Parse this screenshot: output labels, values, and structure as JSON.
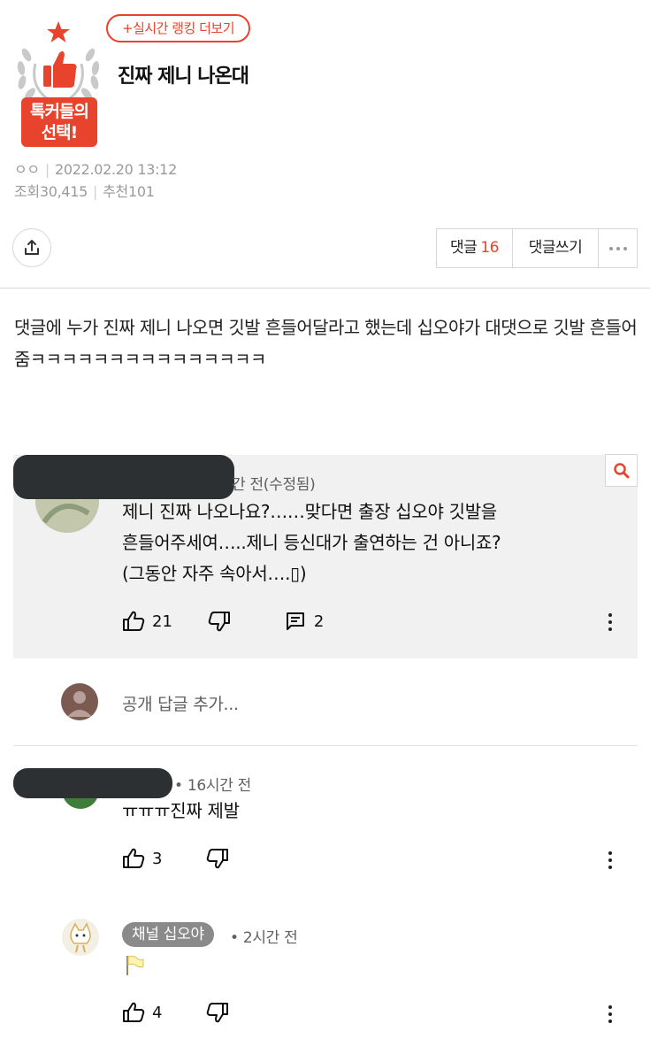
{
  "header": {
    "badge_text_1": "톡커들의",
    "badge_text_2": "선택!",
    "ranking_button": "+실시간 랭킹 더보기",
    "title": "진짜 제니 나온대"
  },
  "meta": {
    "author": "ㅇㅇ",
    "datetime": "2022.02.20 13:12",
    "views_label": "조회",
    "views": "30,415",
    "likes_label": "추천",
    "likes": "101"
  },
  "actions": {
    "comments_label": "댓글",
    "comments_count": "16",
    "write_label": "댓글쓰기"
  },
  "post": {
    "body": "댓글에 누가 진짜 제니 나오면 깃발 흔들어달라고 했는데 십오야가 대댓으로 깃발 흔들어줌ㅋㅋㅋㅋㅋㅋㅋㅋㅋㅋㅋㅋㅋㅋㅋ"
  },
  "screenshot": {
    "comment1": {
      "meta": "간 전(수정됨)",
      "lines": [
        "제니 진짜 나오나요?……맞다면 출장 십오야 깃발을",
        "흔들어주세여…..제니 등신대가 출연하는 건 아니죠?",
        "(그동안 자주 속아서….▯)"
      ],
      "likes": "21",
      "replies": "2"
    },
    "reply_placeholder": "공개 답글 추가...",
    "comment2": {
      "meta": "• 16시간 전",
      "text": "ㅠㅠㅠ진짜 제발",
      "likes": "3"
    },
    "comment3": {
      "channel": "채널 십오야",
      "meta": "• 2시간 전",
      "text": "🏳",
      "likes": "4"
    }
  },
  "colors": {
    "accent": "#e8432c",
    "muted": "#9a9a9a",
    "yt_bg": "#f1f1f1",
    "redaction": "#2c3033"
  }
}
